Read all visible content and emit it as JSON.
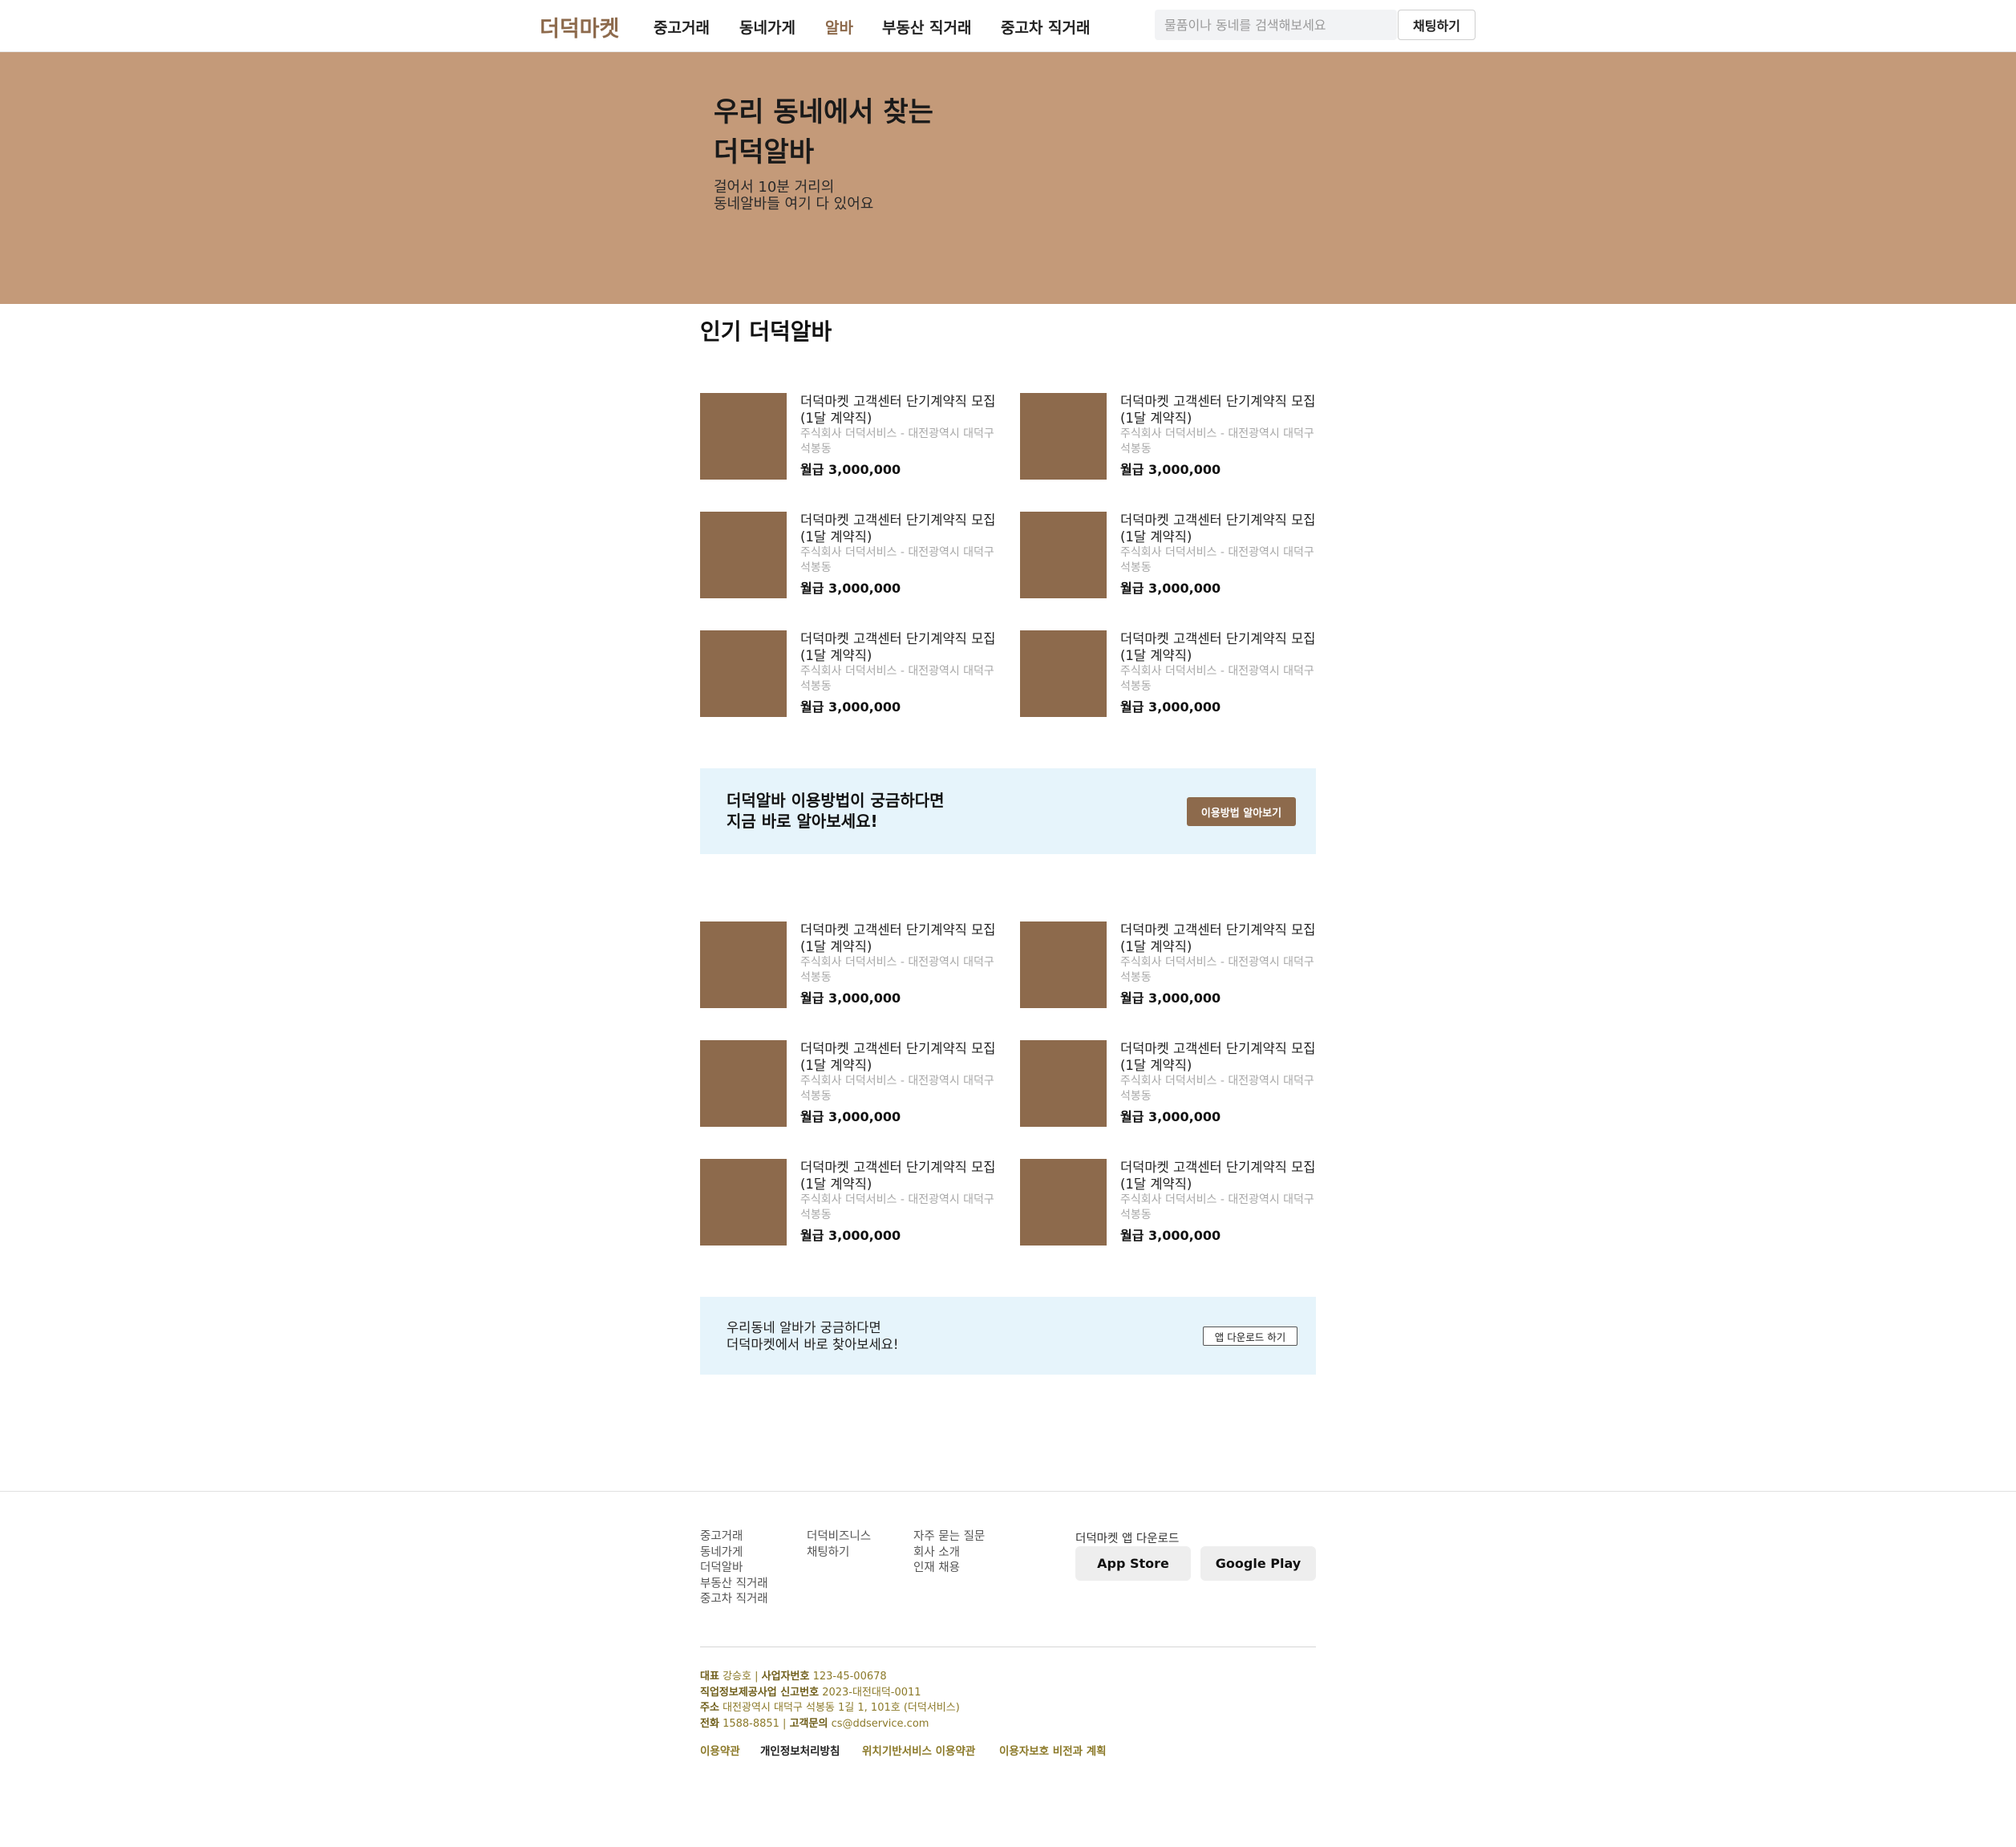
{
  "header": {
    "logo": "더덕마켓",
    "nav": [
      "중고거래",
      "동네가게",
      "알바",
      "부동산 직거래",
      "중고차 직거래"
    ],
    "active_nav": "알바",
    "search_placeholder": "물품이나 동네를 검색해보세요",
    "chat_button": "채팅하기"
  },
  "hero": {
    "title_line1": "우리 동네에서 찾는",
    "title_line2": "더덕알바",
    "sub_line1": "걸어서 10분 거리의",
    "sub_line2": "동네알바들 여기 다 있어요"
  },
  "section_title": "인기 더덕알바",
  "jobs": [
    {
      "title": "더덕마켓 고객센터 단기계약직 모집(1달 계약직)",
      "company": "주식회사 더덕서비스 - 대전광역시 대덕구 석봉동",
      "pay": "월급 3,000,000"
    },
    {
      "title": "더덕마켓 고객센터 단기계약직 모집(1달 계약직)",
      "company": "주식회사 더덕서비스 - 대전광역시 대덕구 석봉동",
      "pay": "월급 3,000,000"
    },
    {
      "title": "더덕마켓 고객센터 단기계약직 모집(1달 계약직)",
      "company": "주식회사 더덕서비스 - 대전광역시 대덕구 석봉동",
      "pay": "월급 3,000,000"
    },
    {
      "title": "더덕마켓 고객센터 단기계약직 모집(1달 계약직)",
      "company": "주식회사 더덕서비스 - 대전광역시 대덕구 석봉동",
      "pay": "월급 3,000,000"
    },
    {
      "title": "더덕마켓 고객센터 단기계약직 모집(1달 계약직)",
      "company": "주식회사 더덕서비스 - 대전광역시 대덕구 석봉동",
      "pay": "월급 3,000,000"
    },
    {
      "title": "더덕마켓 고객센터 단기계약직 모집(1달 계약직)",
      "company": "주식회사 더덕서비스 - 대전광역시 대덕구 석봉동",
      "pay": "월급 3,000,000"
    },
    {
      "title": "더덕마켓 고객센터 단기계약직 모집(1달 계약직)",
      "company": "주식회사 더덕서비스 - 대전광역시 대덕구 석봉동",
      "pay": "월급 3,000,000"
    },
    {
      "title": "더덕마켓 고객센터 단기계약직 모집(1달 계약직)",
      "company": "주식회사 더덕서비스 - 대전광역시 대덕구 석봉동",
      "pay": "월급 3,000,000"
    },
    {
      "title": "더덕마켓 고객센터 단기계약직 모집(1달 계약직)",
      "company": "주식회사 더덕서비스 - 대전광역시 대덕구 석봉동",
      "pay": "월급 3,000,000"
    },
    {
      "title": "더덕마켓 고객센터 단기계약직 모집(1달 계약직)",
      "company": "주식회사 더덕서비스 - 대전광역시 대덕구 석봉동",
      "pay": "월급 3,000,000"
    },
    {
      "title": "더덕마켓 고객센터 단기계약직 모집(1달 계약직)",
      "company": "주식회사 더덕서비스 - 대전광역시 대덕구 석봉동",
      "pay": "월급 3,000,000"
    },
    {
      "title": "더덕마켓 고객센터 단기계약직 모집(1달 계약직)",
      "company": "주식회사 더덕서비스 - 대전광역시 대덕구 석봉동",
      "pay": "월급 3,000,000"
    }
  ],
  "banner1": {
    "line1": "더덕알바 이용방법이 궁금하다면",
    "line2": "지금 바로 알아보세요!",
    "button": "이용방법 알아보기"
  },
  "banner2": {
    "line1": "우리동네 알바가 궁금하다면",
    "line2": "더덕마켓에서 바로 찾아보세요!",
    "button": "앱 다운로드 하기"
  },
  "footer": {
    "col1": [
      "중고거래",
      "동네가게",
      "더덕알바",
      "부동산 직거래",
      "중고차 직거래"
    ],
    "col2": [
      "더덕비즈니스",
      "채팅하기"
    ],
    "col3": [
      "자주 묻는 질문",
      "회사 소개",
      "인재 채용"
    ],
    "app_title": "더덕마켓 앱 다운로드",
    "app_store": "App Store",
    "google_play": "Google Play",
    "company": {
      "ceo_label": "대표",
      "ceo": "강승호",
      "biz_label": "사업자번호",
      "biz": "123-45-00678",
      "job_label": "직업정보제공사업 신고번호",
      "job": "2023-대전대덕-0011",
      "addr_label": "주소",
      "addr": "대전광역시 대덕구 석봉동 1길 1, 101호 (더덕서비스)",
      "tel_label": "전화",
      "tel": "1588-8851",
      "cs_label": "고객문의",
      "cs": "cs@ddservice.com"
    },
    "policies": [
      "이용약관",
      "개인정보처리방침",
      "위치기반서비스 이용약관",
      "이용자보호 비전과 계획"
    ]
  }
}
